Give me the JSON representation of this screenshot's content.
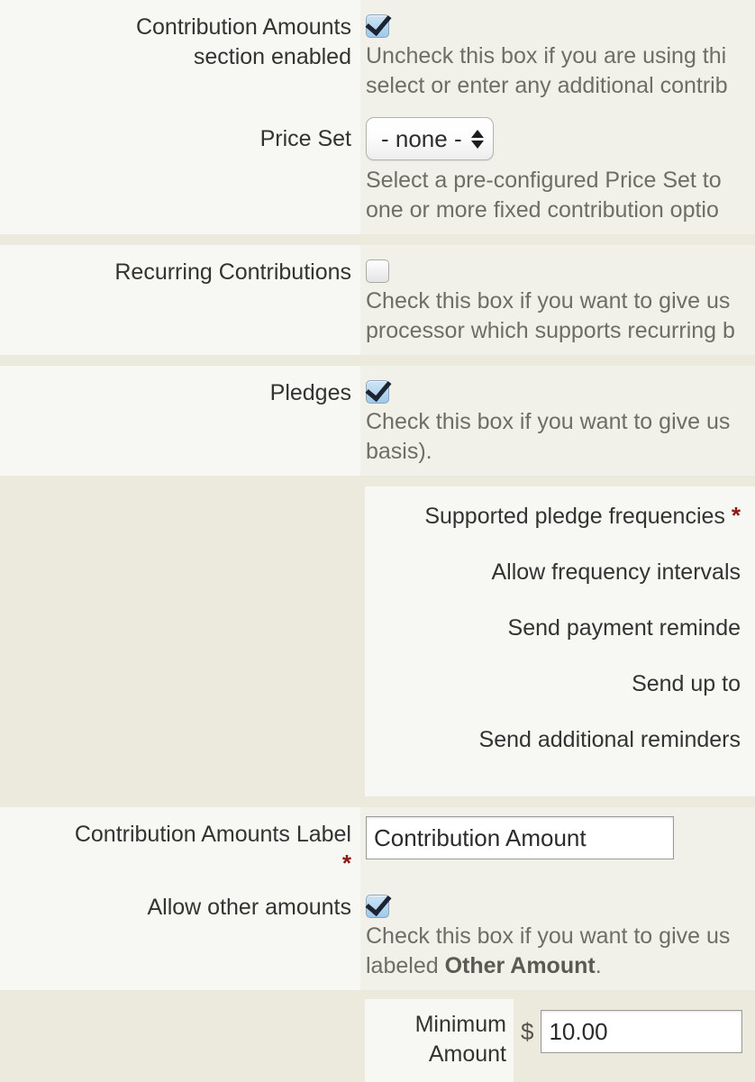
{
  "colors": {
    "page_background": "#ece9dd",
    "label_cell_background": "#f7f7f4",
    "content_cell_background": "#f1f0e9",
    "required_asterisk": "#8b1a10",
    "description_text": "#6e6e66",
    "checkbox_checked_fill": "#9fc9ea"
  },
  "rows": [
    {
      "id": "contribution-amounts-section-enabled",
      "label_lines": [
        "Contribution Amounts",
        "section enabled"
      ],
      "required": false,
      "control": "checkbox",
      "checked": true,
      "description_lines": [
        "Uncheck this box if you are using thi",
        "select or enter any additional contrib"
      ]
    },
    {
      "id": "price-set",
      "label_lines": [
        "Price Set"
      ],
      "required": false,
      "control": "select",
      "selected_option": "- none -",
      "description_lines": [
        "Select a pre-configured Price Set to ",
        "one or more fixed contribution optio"
      ]
    },
    {
      "id": "recurring-contributions",
      "label_lines": [
        "Recurring Contributions"
      ],
      "required": false,
      "control": "checkbox",
      "checked": false,
      "description_lines": [
        "Check this box if you want to give us",
        "processor which supports recurring b"
      ]
    },
    {
      "id": "pledges",
      "label_lines": [
        "Pledges"
      ],
      "required": false,
      "control": "checkbox",
      "checked": true,
      "description_lines": [
        "Check this box if you want to give us",
        "basis)."
      ]
    }
  ],
  "pledge_block": {
    "id": "pledge-settings",
    "sub_rows": [
      {
        "id": "supported-pledge-frequencies",
        "label": "Supported pledge frequencies",
        "required": true
      },
      {
        "id": "allow-frequency-intervals",
        "label": "Allow frequency intervals",
        "required": false
      },
      {
        "id": "send-payment-reminders",
        "label": "Send payment reminde",
        "required": false
      },
      {
        "id": "send-up-to",
        "label": "Send up to",
        "required": false
      },
      {
        "id": "send-additional-reminders",
        "label": "Send additional reminders",
        "required": false
      }
    ]
  },
  "amounts_label_row": {
    "id": "contribution-amounts-label",
    "label_lines": [
      "Contribution Amounts Label"
    ],
    "required": true,
    "value": "Contribution Amount"
  },
  "allow_other_amounts_row": {
    "id": "allow-other-amounts",
    "label_lines": [
      "Allow other amounts"
    ],
    "checked": true,
    "description_prefix": "Check this box if you want to give us",
    "description_line2_prefix": "labeled ",
    "description_line2_bold": "Other Amount",
    "description_line2_suffix": "."
  },
  "minimum_amount_row": {
    "id": "minimum-amount",
    "label_lines": [
      "Minimum",
      "Amount"
    ],
    "currency_symbol": "$",
    "value": "10.00"
  }
}
